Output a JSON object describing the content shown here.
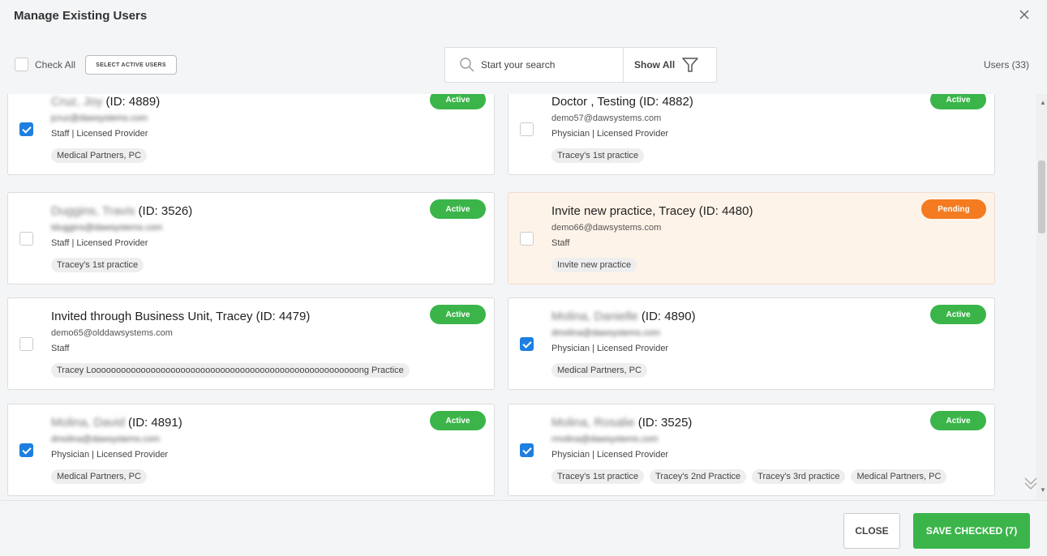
{
  "dialog": {
    "title": "Manage Existing Users",
    "check_all_label": "Check All",
    "select_active_label": "SELECT ACTIVE USERS",
    "search_placeholder": "Start your search",
    "filter_label": "Show All",
    "users_count": "Users (33)"
  },
  "users": [
    {
      "name": "Cruz, Joy",
      "id": " (ID: 4889)",
      "email": "jcruz@dawsystems.com",
      "role": "Staff | Licensed Provider",
      "tags": [
        "Medical Partners, PC"
      ],
      "status": "Active",
      "checked": true,
      "blurred": true,
      "pending": false
    },
    {
      "name": "Doctor , Testing",
      "id": " (ID: 4882)",
      "email": "demo57@dawsystems.com",
      "role": "Physician | Licensed Provider",
      "tags": [
        "Tracey's 1st practice"
      ],
      "status": "Active",
      "checked": false,
      "blurred": false,
      "pending": false
    },
    {
      "name": "Duggins, Travis",
      "id": " (ID: 3526)",
      "email": "tduggins@dawsystems.com",
      "role": "Staff | Licensed Provider",
      "tags": [
        "Tracey's 1st practice"
      ],
      "status": "Active",
      "checked": false,
      "blurred": true,
      "pending": false
    },
    {
      "name": "Invite new practice, Tracey",
      "id": " (ID: 4480)",
      "email": "demo66@dawsystems.com",
      "role": "Staff",
      "tags": [
        "Invite new practice"
      ],
      "status": "Pending",
      "checked": false,
      "blurred": false,
      "pending": true
    },
    {
      "name": "Invited through Business Unit, Tracey",
      "id": " (ID: 4479)",
      "email": "demo65@olddawsystems.com",
      "role": "Staff",
      "tags": [
        "Tracey Loooooooooooooooooooooooooooooooooooooooooooooooooooooong Practice"
      ],
      "status": "Active",
      "checked": false,
      "blurred": false,
      "pending": false
    },
    {
      "name": "Molina, Danielle",
      "id": " (ID: 4890)",
      "email": "dmolina@dawsystems.com",
      "role": "Physician | Licensed Provider",
      "tags": [
        "Medical Partners, PC"
      ],
      "status": "Active",
      "checked": true,
      "blurred": true,
      "pending": false
    },
    {
      "name": "Molina, David",
      "id": " (ID: 4891)",
      "email": "dmolina@dawsystems.com",
      "role": "Physician | Licensed Provider",
      "tags": [
        "Medical Partners, PC"
      ],
      "status": "Active",
      "checked": true,
      "blurred": true,
      "pending": false
    },
    {
      "name": "Molina, Rosalie",
      "id": " (ID: 3525)",
      "email": "rmolina@dawsystems.com",
      "role": "Physician | Licensed Provider",
      "tags": [
        "Tracey's 1st practice",
        "Tracey's 2nd Practice",
        "Tracey's 3rd practice",
        "Medical Partners, PC"
      ],
      "status": "Active",
      "checked": true,
      "blurred": true,
      "pending": false
    }
  ],
  "footer": {
    "close_label": "CLOSE",
    "save_label": "SAVE CHECKED (7)"
  },
  "colors": {
    "active_badge": "#3bb54a",
    "pending_badge": "#f47b20",
    "checkbox_checked": "#1e7fe0",
    "pending_card_bg": "#fef3e8"
  }
}
